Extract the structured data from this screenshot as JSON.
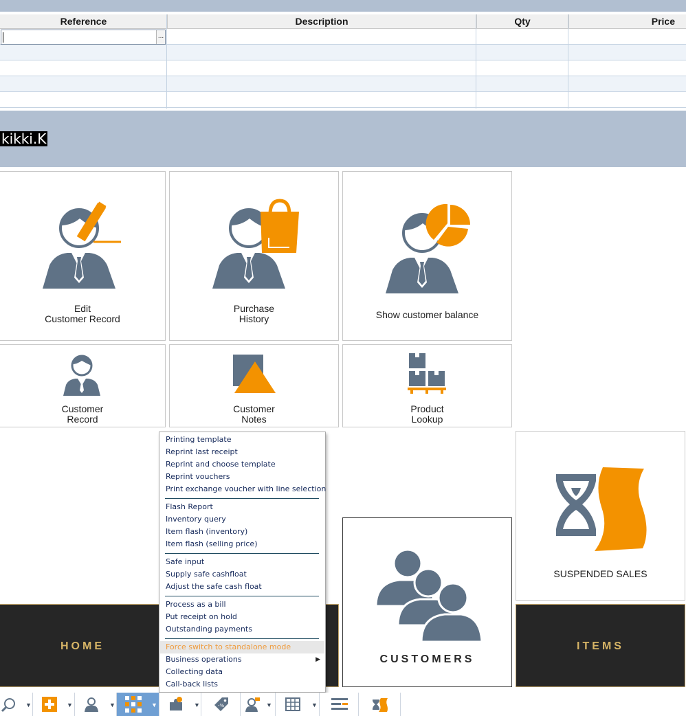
{
  "grid": {
    "columns": [
      "Reference",
      "Description",
      "Qty",
      "Price"
    ],
    "ellipsis": "..."
  },
  "user": {
    "name": "kikki.K"
  },
  "tiles": {
    "edit_customer": "Edit\nCustomer Record",
    "purchase_history": "Purchase\nHistory",
    "show_balance": "Show customer balance",
    "customer_record": "Customer\nRecord",
    "customer_notes": "Customer\nNotes",
    "product_lookup": "Product\nLookup",
    "suspended_sales": "SUSPENDED SALES",
    "customers": "CUSTOMERS"
  },
  "nav": {
    "home": "HOME",
    "items": "ITEMS"
  },
  "menu": {
    "items": [
      "Printing template",
      "Reprint last receipt",
      "Reprint and choose template",
      "Reprint vouchers",
      "Print exchange voucher with line selection",
      "Flash Report",
      "Inventory query",
      "Item flash (inventory)",
      "Item flash (selling price)",
      "Safe input",
      "Supply safe cashfloat",
      "Adjust the safe cash float",
      "Process as a bill",
      "Put receipt on hold",
      "Outstanding payments",
      "Force switch to standalone mode",
      "Business operations",
      "Collecting data",
      "Call-back lists"
    ],
    "highlighted_index": 15,
    "submenu_arrow": "▶"
  },
  "toolbar": {
    "icons": [
      "search-icon",
      "add-icon",
      "customer-icon",
      "apps-grid-icon",
      "puzzle-icon",
      "discount-tag-icon",
      "salesperson-icon",
      "table-icon",
      "lines-icon",
      "hourglass-icon"
    ],
    "dropdown_glyph": "▼"
  },
  "colors": {
    "accent_orange": "#f39200",
    "slate": "#5f7286",
    "band": "#b1bfd1",
    "nav_gold": "#d6b466",
    "nav_dark": "#262626",
    "toolbar_active": "#6f9fd3"
  }
}
